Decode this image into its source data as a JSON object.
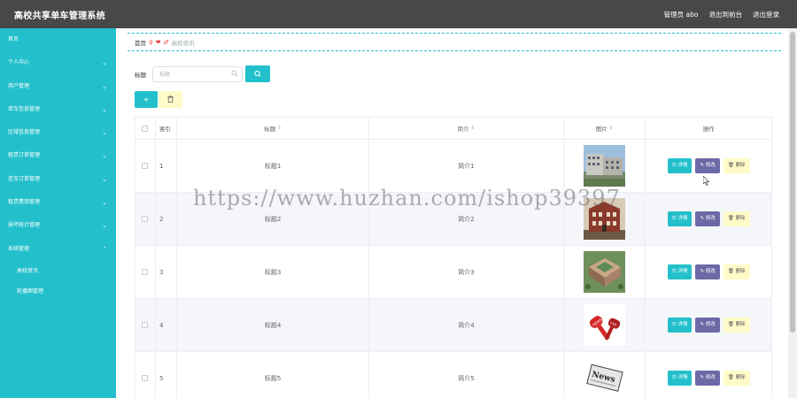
{
  "app": {
    "title": "高校共享单车管理系统"
  },
  "topbar": {
    "user": "管理员 abo",
    "back_to_front": "退出到前台",
    "logout": "退出登录"
  },
  "sidebar": {
    "items": [
      {
        "label": "首页",
        "has_children": false
      },
      {
        "label": "个人中心",
        "has_children": true
      },
      {
        "label": "用户管理",
        "has_children": true
      },
      {
        "label": "单车信息管理",
        "has_children": true
      },
      {
        "label": "区域信息管理",
        "has_children": true
      },
      {
        "label": "租赁订单管理",
        "has_children": true
      },
      {
        "label": "还车订单管理",
        "has_children": true
      },
      {
        "label": "租赁费用管理",
        "has_children": true
      },
      {
        "label": "损坏统计管理",
        "has_children": true
      },
      {
        "label": "系统管理",
        "has_children": true,
        "expanded": true
      }
    ],
    "subitems": [
      {
        "label": "高校资讯"
      },
      {
        "label": "轮播图管理"
      }
    ]
  },
  "breadcrumb": {
    "home": "首页",
    "current": "高校资讯"
  },
  "search": {
    "label": "标题",
    "placeholder": "标题",
    "value": ""
  },
  "toolbar": {
    "add_label": "+",
    "batch_delete_icon": "trash-icon"
  },
  "table": {
    "headers": {
      "index": "索引",
      "title": "标题",
      "intro": "简介",
      "image": "图片",
      "ops": "操作"
    },
    "rows": [
      {
        "index": "1",
        "title": "标题1",
        "intro": "简介1",
        "image": "campus-building"
      },
      {
        "index": "2",
        "title": "标题2",
        "intro": "简介2",
        "image": "brick-building"
      },
      {
        "index": "3",
        "title": "标题3",
        "intro": "简介3",
        "image": "campus-aerial"
      },
      {
        "index": "4",
        "title": "标题4",
        "intro": "简介4",
        "image": "microphone-live"
      },
      {
        "index": "5",
        "title": "标题5",
        "intro": "简介5",
        "image": "news-paper"
      }
    ],
    "ops": {
      "detail": "详情",
      "edit": "修改",
      "delete": "删除"
    }
  },
  "watermark": "https://www.huzhan.com/ishop39397",
  "colors": {
    "accent": "#23c0cc",
    "edit": "#6b6aa6",
    "delete": "#fffbc8",
    "topbar": "#484848"
  }
}
